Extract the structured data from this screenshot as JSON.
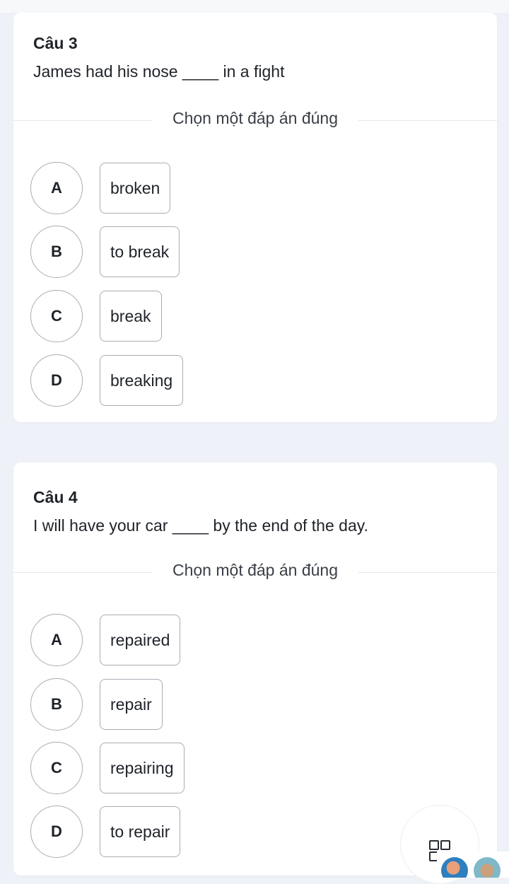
{
  "divider_label": "Chọn một đáp án đúng",
  "questions": [
    {
      "title": "Câu 3",
      "text": "James had his nose ____ in a fight",
      "options": [
        {
          "letter": "A",
          "text": "broken"
        },
        {
          "letter": "B",
          "text": "to break"
        },
        {
          "letter": "C",
          "text": "break"
        },
        {
          "letter": "D",
          "text": "breaking"
        }
      ]
    },
    {
      "title": "Câu 4",
      "text": "I will have your car ____ by the end of the day.",
      "options": [
        {
          "letter": "A",
          "text": "repaired"
        },
        {
          "letter": "B",
          "text": "repair"
        },
        {
          "letter": "C",
          "text": "repairing"
        },
        {
          "letter": "D",
          "text": "to repair"
        }
      ]
    }
  ],
  "fab": {
    "icon": "grid-menu-icon"
  },
  "colors": {
    "background": "#eef1f7",
    "card": "#ffffff",
    "border": "#a9adb3",
    "text": "#1f2329"
  }
}
